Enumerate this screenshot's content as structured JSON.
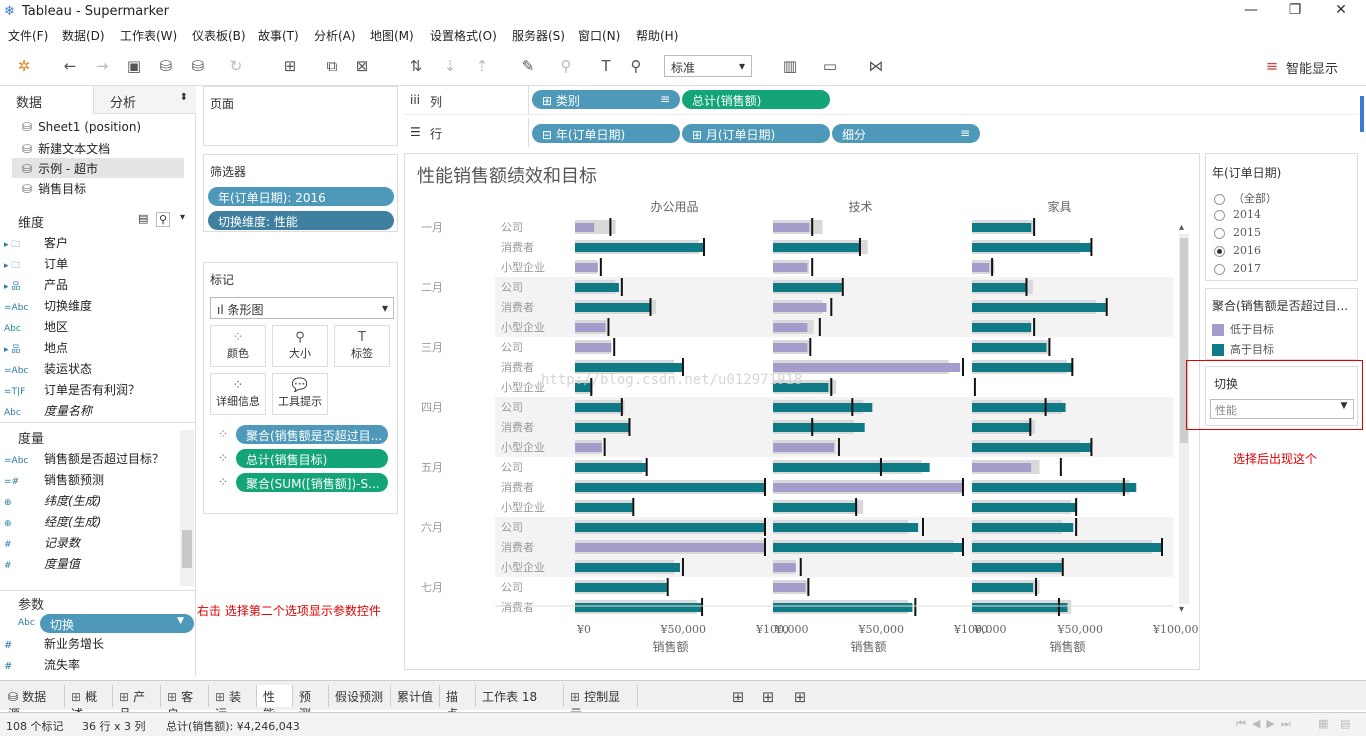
{
  "window": {
    "title": "Tableau - Supermarker"
  },
  "menu": [
    "文件(F)",
    "数据(D)",
    "工作表(W)",
    "仪表板(B)",
    "故事(T)",
    "分析(A)",
    "地图(M)",
    "设置格式(O)",
    "服务器(S)",
    "窗口(N)",
    "帮助(H)"
  ],
  "toolbar": {
    "fit_select": "标准",
    "smart_show": "智能显示"
  },
  "left_tabs": {
    "data": "数据",
    "analysis": "分析"
  },
  "datasources": [
    "Sheet1 (position)",
    "新建文本文档",
    "示例 - 超市",
    "销售目标"
  ],
  "dimensions": {
    "title": "维度",
    "items": [
      {
        "icon": "▸ 🗀",
        "label": "客户"
      },
      {
        "icon": "▸ 🗀",
        "label": "订单"
      },
      {
        "icon": "▸ 品",
        "label": "产品"
      },
      {
        "icon": "=Abc",
        "label": "切换维度"
      },
      {
        "icon": "Abc",
        "label": "地区"
      },
      {
        "icon": "▸ 品",
        "label": "地点"
      },
      {
        "icon": "=Abc",
        "label": "装运状态"
      },
      {
        "icon": "=T|F",
        "label": "订单是否有利润？"
      },
      {
        "icon": "Abc",
        "label": "度量名称"
      }
    ]
  },
  "measures": {
    "title": "度量",
    "items": [
      {
        "icon": "=Abc",
        "label": "销售额是否超过目标？"
      },
      {
        "icon": "=#",
        "label": "销售额预测"
      },
      {
        "icon": "⊕",
        "label": "纬度(生成)"
      },
      {
        "icon": "⊕",
        "label": "经度(生成)"
      },
      {
        "icon": "#",
        "label": "记录数"
      },
      {
        "icon": "#",
        "label": "度量值"
      }
    ]
  },
  "parameters": {
    "title": "参数",
    "items": [
      {
        "icon": "Abc",
        "label": "切换"
      },
      {
        "icon": "#",
        "label": "新业务增长"
      },
      {
        "icon": "#",
        "label": "流失率"
      }
    ]
  },
  "pages": {
    "title": "页面"
  },
  "filters": {
    "title": "筛选器",
    "items": [
      "年(订单日期): 2016",
      "切换维度: 性能"
    ]
  },
  "marks": {
    "title": "标记",
    "type": "条形图",
    "buttons": [
      "颜色",
      "大小",
      "标签",
      "详细信息",
      "工具提示"
    ],
    "fields": [
      "聚合(销售额是否超过目...",
      "总计(销售目标)",
      "聚合(SUM([销售额])-S..."
    ]
  },
  "shelves": {
    "columns_label": "列",
    "rows_label": "行",
    "columns": [
      "类别",
      "总计(销售额)"
    ],
    "rows": [
      "年(订单日期)",
      "月(订单日期)",
      "细分"
    ]
  },
  "chart_data": {
    "type": "bar",
    "title": "性能销售额绩效和目标",
    "xlabel": "销售额",
    "panes": [
      "办公用品",
      "技术",
      "家具"
    ],
    "months": [
      "一月",
      "二月",
      "三月",
      "四月",
      "五月",
      "六月",
      "七月"
    ],
    "segments": [
      "公司",
      "消费者",
      "小型企业"
    ],
    "xlim": [
      0,
      100000
    ],
    "xticks": [
      "¥0",
      "¥50,000",
      "¥100,000"
    ],
    "legend": {
      "title": "聚合(销售额是否超过目...",
      "items": [
        {
          "label": "低于目标",
          "color": "#a59ccc"
        },
        {
          "label": "高于目标",
          "color": "#0e7a86"
        }
      ]
    },
    "rows": [
      {
        "month": "一月",
        "segment": "公司",
        "values": [
          {
            "actual": 10,
            "target": 18,
            "ref": 18
          },
          {
            "actual": 19,
            "target": 22,
            "ref": 20
          },
          {
            "actual": 31,
            "target": 28,
            "ref": 32
          }
        ]
      },
      {
        "month": "一月",
        "segment": "消费者",
        "values": [
          {
            "actual": 67,
            "target": 55,
            "ref": 67
          },
          {
            "actual": 45,
            "target": 42,
            "ref": 45
          },
          {
            "actual": 62,
            "target": 48,
            "ref": 62
          }
        ]
      },
      {
        "month": "一月",
        "segment": "小型企业",
        "values": [
          {
            "actual": 12,
            "target": 10,
            "ref": 13
          },
          {
            "actual": 18,
            "target": 16,
            "ref": 20
          },
          {
            "actual": 9,
            "target": 10,
            "ref": 10
          }
        ]
      },
      {
        "month": "二月",
        "segment": "公司",
        "values": [
          {
            "actual": 23,
            "target": 18,
            "ref": 24
          },
          {
            "actual": 36,
            "target": 30,
            "ref": 36
          },
          {
            "actual": 28,
            "target": 27,
            "ref": 28
          }
        ]
      },
      {
        "month": "二月",
        "segment": "消费者",
        "values": [
          {
            "actual": 39,
            "target": 36,
            "ref": 39
          },
          {
            "actual": 28,
            "target": 22,
            "ref": 30
          },
          {
            "actual": 70,
            "target": 55,
            "ref": 70
          }
        ]
      },
      {
        "month": "二月",
        "segment": "小型企业",
        "values": [
          {
            "actual": 16,
            "target": 14,
            "ref": 17
          },
          {
            "actual": 18,
            "target": 18,
            "ref": 24
          },
          {
            "actual": 31,
            "target": 26,
            "ref": 32
          }
        ]
      },
      {
        "month": "三月",
        "segment": "公司",
        "values": [
          {
            "actual": 19,
            "target": 16,
            "ref": 20
          },
          {
            "actual": 18,
            "target": 16,
            "ref": 19
          },
          {
            "actual": 39,
            "target": 34,
            "ref": 40
          }
        ]
      },
      {
        "month": "三月",
        "segment": "消费者",
        "values": [
          {
            "actual": 56,
            "target": 44,
            "ref": 56
          },
          {
            "actual": 98,
            "target": 78,
            "ref": 108
          },
          {
            "actual": 53,
            "target": 42,
            "ref": 52
          }
        ]
      },
      {
        "month": "三月",
        "segment": "小型企业",
        "values": [
          {
            "actual": 8,
            "target": 8,
            "ref": 8
          },
          {
            "actual": 29,
            "target": 28,
            "ref": 30
          },
          {
            "actual": 0,
            "target": 0,
            "ref": 1
          }
        ]
      },
      {
        "month": "四月",
        "segment": "公司",
        "values": [
          {
            "actual": 24,
            "target": 22,
            "ref": 24
          },
          {
            "actual": 52,
            "target": 40,
            "ref": 41
          },
          {
            "actual": 49,
            "target": 40,
            "ref": 38
          }
        ]
      },
      {
        "month": "四月",
        "segment": "消费者",
        "values": [
          {
            "actual": 28,
            "target": 24,
            "ref": 28
          },
          {
            "actual": 48,
            "target": 36,
            "ref": 20
          },
          {
            "actual": 31,
            "target": 28,
            "ref": 30
          }
        ]
      },
      {
        "month": "四月",
        "segment": "小型企业",
        "values": [
          {
            "actual": 14,
            "target": 12,
            "ref": 15
          },
          {
            "actual": 32,
            "target": 28,
            "ref": 34
          },
          {
            "actual": 62,
            "target": 48,
            "ref": 62
          }
        ]
      },
      {
        "month": "五月",
        "segment": "公司",
        "values": [
          {
            "actual": 37,
            "target": 30,
            "ref": 37
          },
          {
            "actual": 82,
            "target": 66,
            "ref": 56
          },
          {
            "actual": 31,
            "target": 30,
            "ref": 46
          }
        ]
      },
      {
        "month": "五月",
        "segment": "消费者",
        "values": [
          {
            "actual": 125,
            "target": 100,
            "ref": 119
          },
          {
            "actual": 135,
            "target": 108,
            "ref": 160
          },
          {
            "actual": 86,
            "target": 70,
            "ref": 79
          }
        ]
      },
      {
        "month": "五月",
        "segment": "小型企业",
        "values": [
          {
            "actual": 30,
            "target": 26,
            "ref": 30
          },
          {
            "actual": 44,
            "target": 40,
            "ref": 43
          },
          {
            "actual": 55,
            "target": 44,
            "ref": 54
          }
        ]
      },
      {
        "month": "六月",
        "segment": "公司",
        "values": [
          {
            "actual": 133,
            "target": 108,
            "ref": 127
          },
          {
            "actual": 76,
            "target": 60,
            "ref": 78
          },
          {
            "actual": 53,
            "target": 40,
            "ref": 54
          }
        ]
      },
      {
        "month": "六月",
        "segment": "消费者",
        "values": [
          {
            "actual": 114,
            "target": 92,
            "ref": 122
          },
          {
            "actual": 100,
            "target": 80,
            "ref": 101
          },
          {
            "actual": 100,
            "target": 80,
            "ref": 102
          }
        ]
      },
      {
        "month": "六月",
        "segment": "小型企业",
        "values": [
          {
            "actual": 55,
            "target": 44,
            "ref": 56
          },
          {
            "actual": 12,
            "target": 10,
            "ref": 14
          },
          {
            "actual": 47,
            "target": 40,
            "ref": 47
          }
        ]
      },
      {
        "month": "七月",
        "segment": "公司",
        "values": [
          {
            "actual": 48,
            "target": 40,
            "ref": 48
          },
          {
            "actual": 17,
            "target": 16,
            "ref": 18
          },
          {
            "actual": 32,
            "target": 30,
            "ref": 33
          }
        ]
      },
      {
        "month": "七月",
        "segment": "消费者",
        "values": [
          {
            "actual": 66,
            "target": 54,
            "ref": 66
          },
          {
            "actual": 73,
            "target": 60,
            "ref": 74
          },
          {
            "actual": 50,
            "target": 44,
            "ref": 45
          }
        ]
      }
    ]
  },
  "year_filter": {
    "title": "年(订单日期)",
    "options": [
      "（全部）",
      "2014",
      "2015",
      "2016",
      "2017"
    ],
    "selected": "2016"
  },
  "param_control": {
    "title": "切换",
    "value": "性能"
  },
  "annotations": {
    "right": "选择后出现这个",
    "left": "右击  选择第二个选项显示参数控件"
  },
  "sheet_tabs": [
    "数据源",
    "概述",
    "产品",
    "客户",
    "装运",
    "性能",
    "预测",
    "假设预测",
    "累计值",
    "描点",
    "工作表 18",
    "控制显示"
  ],
  "active_tab": "性能",
  "status": {
    "marks": "108 个标记",
    "grid": "36 行 x 3 列",
    "total": "总计(销售额): ¥4,246,043"
  },
  "watermark": "http://blog.csdn.net/u012971918"
}
